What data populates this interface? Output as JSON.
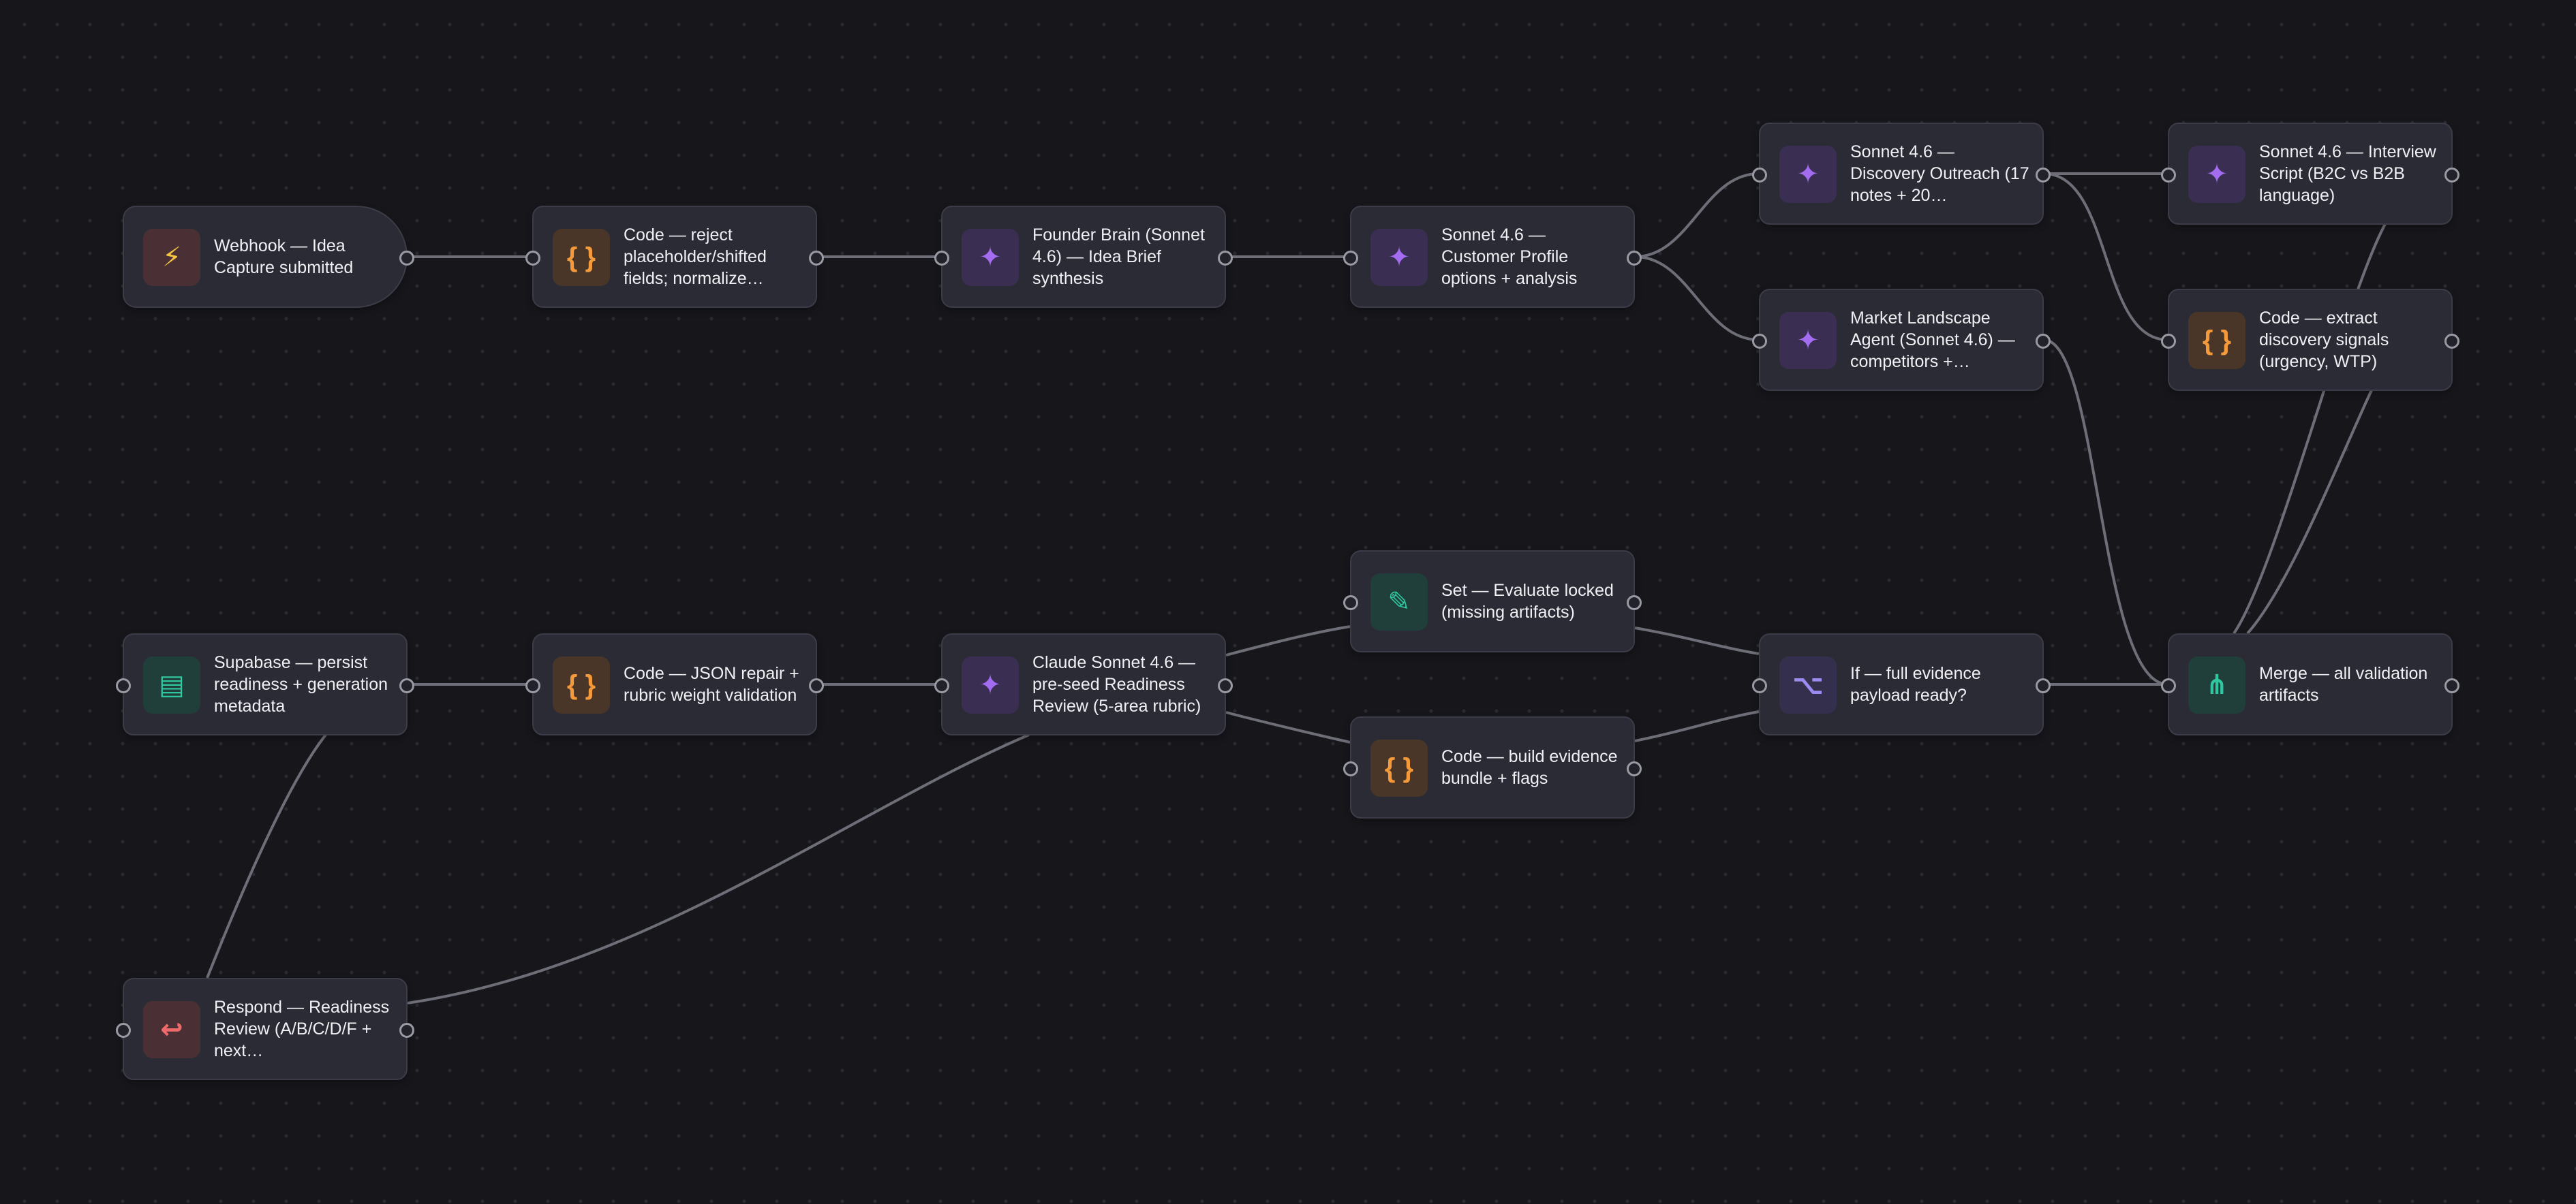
{
  "colors": {
    "background": "#16161b",
    "node_bg": "#2b2b35",
    "node_border": "#3c3c48",
    "edge": "#6e6e78",
    "code_icon": "#f59a3a",
    "ai_icon": "#a46cf0",
    "db_icon": "#2fc7a0",
    "respond_icon": "#ef6a6a"
  },
  "nodes": {
    "webhook": {
      "label": "Webhook — Idea Capture submitted",
      "icon": "lightning-icon",
      "glyph": "⚡"
    },
    "code_reject": {
      "label": "Code — reject placeholder/shifted fields; normalize…",
      "icon": "code-braces-icon",
      "glyph": "{ }"
    },
    "founder_brain": {
      "label": "Founder Brain (Sonnet 4.6) — Idea Brief synthesis",
      "icon": "sparkle-icon",
      "glyph": "✦"
    },
    "customer_profile": {
      "label": "Sonnet 4.6 — Customer Profile options + analysis",
      "icon": "sparkle-icon",
      "glyph": "✦"
    },
    "discovery_outreach": {
      "label": "Sonnet 4.6 — Discovery Outreach (17 notes + 20…",
      "icon": "sparkle-icon",
      "glyph": "✦"
    },
    "market_landscape": {
      "label": "Market Landscape Agent (Sonnet 4.6) — competitors +…",
      "icon": "sparkle-icon",
      "glyph": "✦"
    },
    "interview_script": {
      "label": "Sonnet 4.6 — Interview Script (B2C vs B2B language)",
      "icon": "sparkle-icon",
      "glyph": "✦"
    },
    "extract_signals": {
      "label": "Code — extract discovery signals (urgency, WTP)",
      "icon": "code-braces-icon",
      "glyph": "{ }"
    },
    "merge": {
      "label": "Merge — all validation artifacts",
      "icon": "merge-icon",
      "glyph": "⋔"
    },
    "if_ready": {
      "label": "If — full evidence payload ready?",
      "icon": "branch-icon",
      "glyph": "⌥"
    },
    "set_locked": {
      "label": "Set — Evaluate locked (missing artifacts)",
      "icon": "pencil-icon",
      "glyph": "✎"
    },
    "build_bundle": {
      "label": "Code — build evidence bundle + flags",
      "icon": "code-braces-icon",
      "glyph": "{ }"
    },
    "readiness_review": {
      "label": "Claude Sonnet 4.6 — pre-seed Readiness Review (5-area rubric)",
      "icon": "sparkle-icon",
      "glyph": "✦"
    },
    "json_repair": {
      "label": "Code — JSON repair + rubric weight validation",
      "icon": "code-braces-icon",
      "glyph": "{ }"
    },
    "supabase": {
      "label": "Supabase — persist readiness + generation metadata",
      "icon": "database-icon",
      "glyph": "▤"
    },
    "respond": {
      "label": "Respond — Readiness Review (A/B/C/D/F + next…",
      "icon": "return-arrow-icon",
      "glyph": "↩"
    }
  }
}
